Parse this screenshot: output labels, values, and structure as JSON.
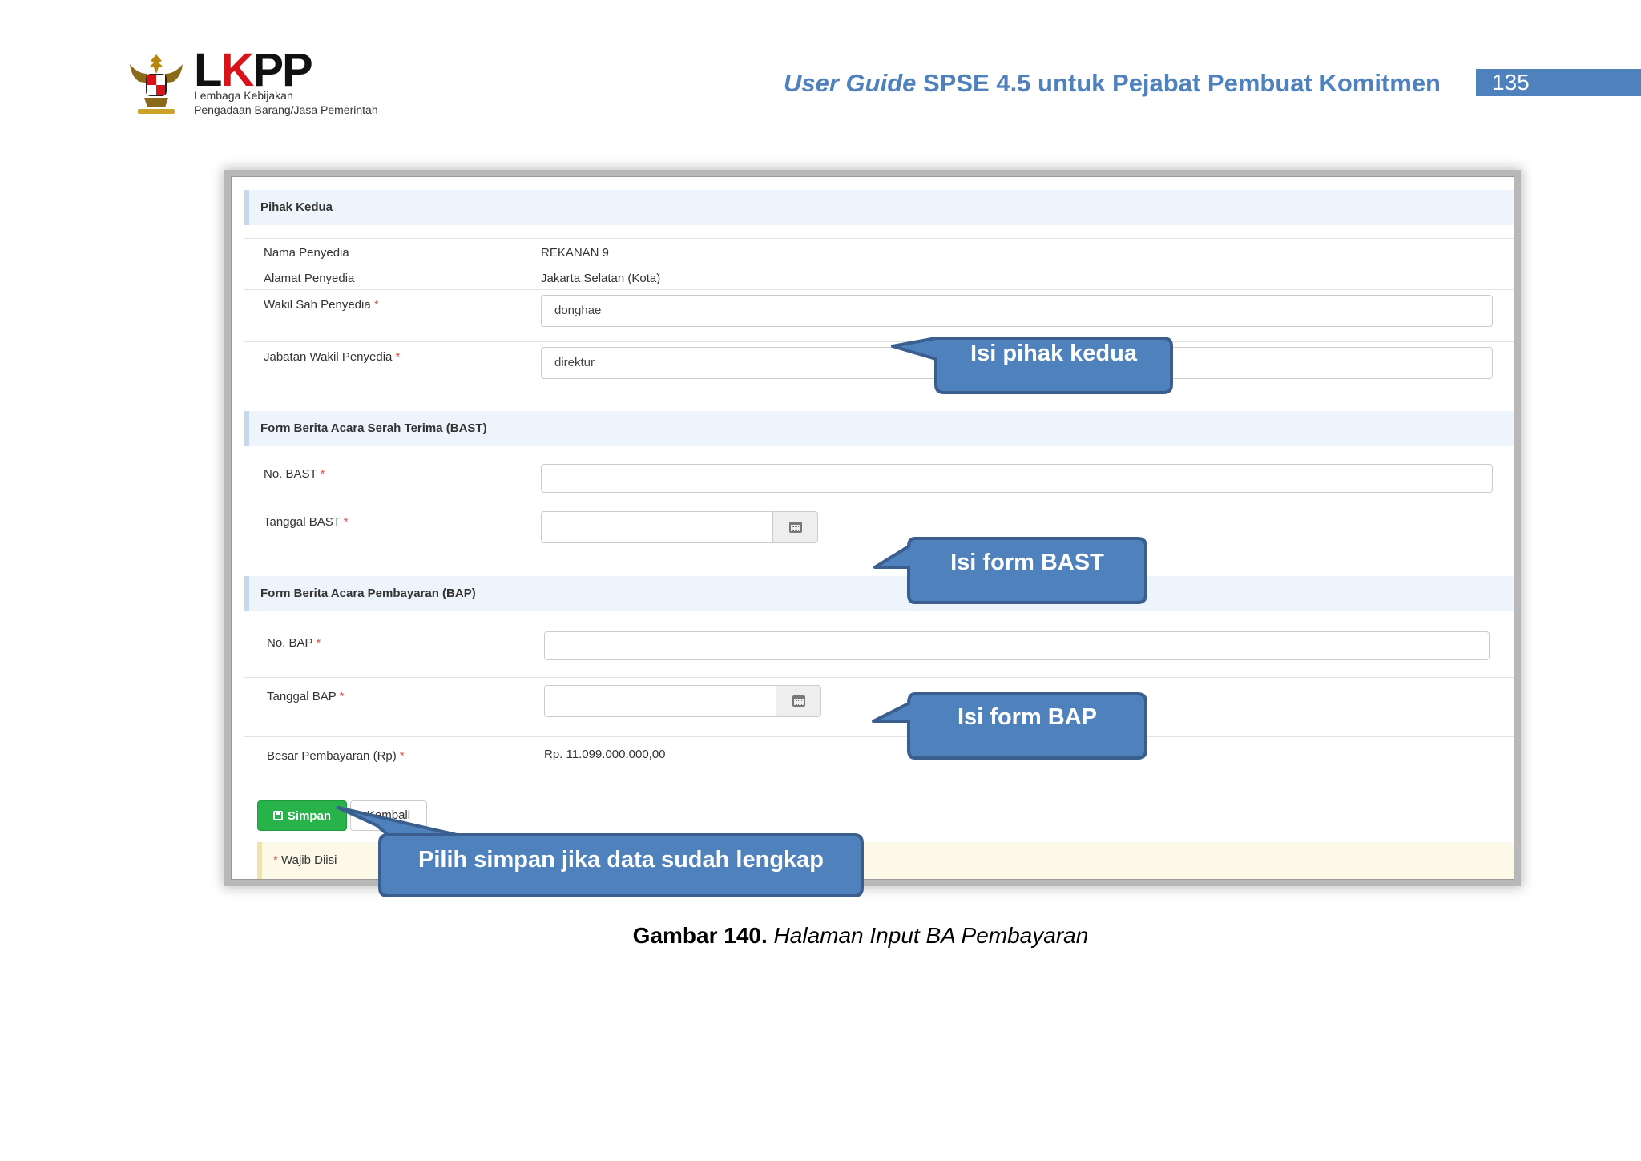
{
  "header": {
    "logo_text": "LKPP",
    "logo_sub_line1": "Lembaga Kebijakan",
    "logo_sub_line2": "Pengadaan Barang/Jasa Pemerintah",
    "doc_title_italic": "User Guide",
    "doc_title_rest": " SPSE 4.5 untuk Pejabat Pembuat Komitmen",
    "page_number": "135"
  },
  "form": {
    "pihak_kedua": {
      "heading": "Pihak Kedua",
      "nama_label": "Nama Penyedia",
      "nama_value": "REKANAN 9",
      "alamat_label": "Alamat Penyedia",
      "alamat_value": "Jakarta Selatan (Kota)",
      "wakil_label": "Wakil Sah Penyedia",
      "wakil_value": "donghae",
      "jabatan_label": "Jabatan Wakil Penyedia",
      "jabatan_value": "direktur"
    },
    "bast": {
      "heading": "Form Berita Acara Serah Terima (BAST)",
      "no_label": "No. BAST",
      "no_value": "",
      "tanggal_label": "Tanggal BAST",
      "tanggal_value": ""
    },
    "bap": {
      "heading": "Form Berita Acara Pembayaran (BAP)",
      "no_label": "No. BAP",
      "no_value": "",
      "tanggal_label": "Tanggal BAP",
      "tanggal_value": "",
      "besar_label": "Besar Pembayaran (Rp)",
      "besar_value": "Rp. 11.099.000.000,00"
    },
    "required_mark": "*",
    "buttons": {
      "simpan": "Simpan",
      "kembali": "Kembali"
    },
    "note": "Wajib Diisi"
  },
  "callouts": {
    "pihak_kedua": "Isi pihak kedua",
    "bast": "Isi form BAST",
    "bap": "Isi form BAP",
    "simpan": "Pilih simpan jika data sudah lengkap"
  },
  "colors": {
    "callout_fill": "#4f81bd",
    "callout_border": "#3a5f8f",
    "save_button": "#28b34a",
    "header_blue": "#4f81bd"
  },
  "caption": {
    "label": "Gambar 140.",
    "text": " Halaman Input BA Pembayaran"
  }
}
